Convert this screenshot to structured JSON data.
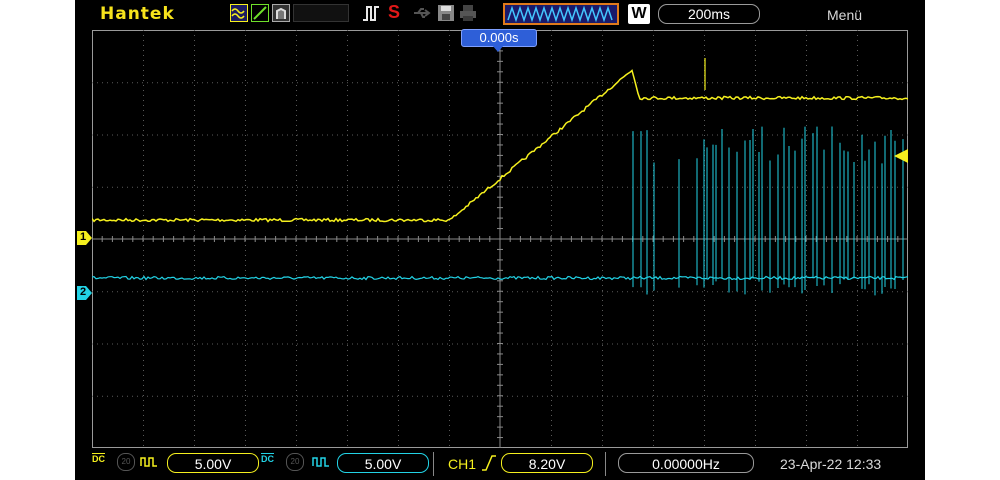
{
  "header": {
    "brand": "Hantek",
    "run_state": "S",
    "timebase_mode": "W",
    "timebase": "200ms",
    "menu_label": "Menü"
  },
  "display": {
    "trigger_time": "0.000s",
    "ch1_marker": "1",
    "ch2_marker": "2"
  },
  "footer": {
    "ch1_coupling": "DC",
    "ch1_scale": "5.00V",
    "ch2_coupling": "DC",
    "ch2_scale": "5.00V",
    "trigger_source": "CH1",
    "trigger_level": "8.20V",
    "frequency": "0.00000Hz",
    "datetime": "23-Apr-22 12:33"
  },
  "colors": {
    "ch1": "#f5f01e",
    "ch2": "#22d3e6",
    "accent_blue": "#2e5fd8"
  },
  "icons": [
    "waveform-icon",
    "trigger-edge-icon",
    "run-stop-icon",
    "usb-icon",
    "save-icon",
    "print-icon",
    "wave-memory-icon"
  ]
}
